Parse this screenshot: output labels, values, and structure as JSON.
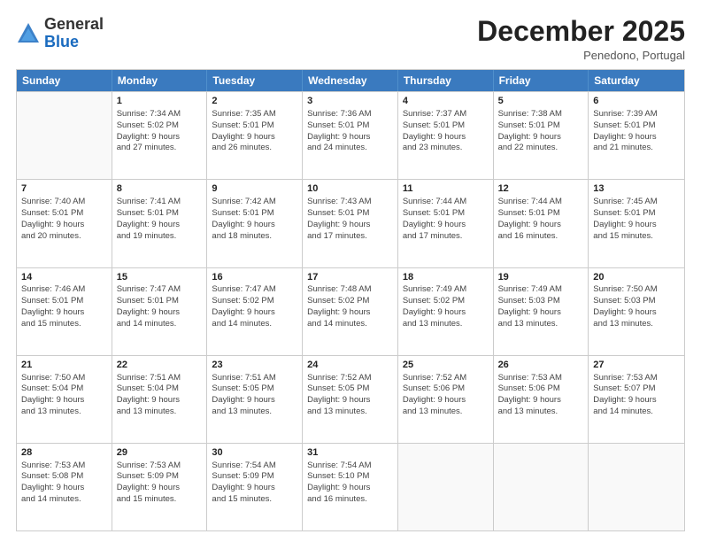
{
  "logo": {
    "general": "General",
    "blue": "Blue"
  },
  "header": {
    "month": "December 2025",
    "location": "Penedono, Portugal"
  },
  "days": [
    "Sunday",
    "Monday",
    "Tuesday",
    "Wednesday",
    "Thursday",
    "Friday",
    "Saturday"
  ],
  "weeks": [
    [
      {
        "day": "",
        "sunrise": "",
        "sunset": "",
        "daylight": "",
        "empty": true
      },
      {
        "day": "1",
        "sunrise": "Sunrise: 7:34 AM",
        "sunset": "Sunset: 5:02 PM",
        "daylight": "Daylight: 9 hours and 27 minutes.",
        "empty": false
      },
      {
        "day": "2",
        "sunrise": "Sunrise: 7:35 AM",
        "sunset": "Sunset: 5:01 PM",
        "daylight": "Daylight: 9 hours and 26 minutes.",
        "empty": false
      },
      {
        "day": "3",
        "sunrise": "Sunrise: 7:36 AM",
        "sunset": "Sunset: 5:01 PM",
        "daylight": "Daylight: 9 hours and 24 minutes.",
        "empty": false
      },
      {
        "day": "4",
        "sunrise": "Sunrise: 7:37 AM",
        "sunset": "Sunset: 5:01 PM",
        "daylight": "Daylight: 9 hours and 23 minutes.",
        "empty": false
      },
      {
        "day": "5",
        "sunrise": "Sunrise: 7:38 AM",
        "sunset": "Sunset: 5:01 PM",
        "daylight": "Daylight: 9 hours and 22 minutes.",
        "empty": false
      },
      {
        "day": "6",
        "sunrise": "Sunrise: 7:39 AM",
        "sunset": "Sunset: 5:01 PM",
        "daylight": "Daylight: 9 hours and 21 minutes.",
        "empty": false
      }
    ],
    [
      {
        "day": "7",
        "sunrise": "Sunrise: 7:40 AM",
        "sunset": "Sunset: 5:01 PM",
        "daylight": "Daylight: 9 hours and 20 minutes.",
        "empty": false
      },
      {
        "day": "8",
        "sunrise": "Sunrise: 7:41 AM",
        "sunset": "Sunset: 5:01 PM",
        "daylight": "Daylight: 9 hours and 19 minutes.",
        "empty": false
      },
      {
        "day": "9",
        "sunrise": "Sunrise: 7:42 AM",
        "sunset": "Sunset: 5:01 PM",
        "daylight": "Daylight: 9 hours and 18 minutes.",
        "empty": false
      },
      {
        "day": "10",
        "sunrise": "Sunrise: 7:43 AM",
        "sunset": "Sunset: 5:01 PM",
        "daylight": "Daylight: 9 hours and 17 minutes.",
        "empty": false
      },
      {
        "day": "11",
        "sunrise": "Sunrise: 7:44 AM",
        "sunset": "Sunset: 5:01 PM",
        "daylight": "Daylight: 9 hours and 17 minutes.",
        "empty": false
      },
      {
        "day": "12",
        "sunrise": "Sunrise: 7:44 AM",
        "sunset": "Sunset: 5:01 PM",
        "daylight": "Daylight: 9 hours and 16 minutes.",
        "empty": false
      },
      {
        "day": "13",
        "sunrise": "Sunrise: 7:45 AM",
        "sunset": "Sunset: 5:01 PM",
        "daylight": "Daylight: 9 hours and 15 minutes.",
        "empty": false
      }
    ],
    [
      {
        "day": "14",
        "sunrise": "Sunrise: 7:46 AM",
        "sunset": "Sunset: 5:01 PM",
        "daylight": "Daylight: 9 hours and 15 minutes.",
        "empty": false
      },
      {
        "day": "15",
        "sunrise": "Sunrise: 7:47 AM",
        "sunset": "Sunset: 5:01 PM",
        "daylight": "Daylight: 9 hours and 14 minutes.",
        "empty": false
      },
      {
        "day": "16",
        "sunrise": "Sunrise: 7:47 AM",
        "sunset": "Sunset: 5:02 PM",
        "daylight": "Daylight: 9 hours and 14 minutes.",
        "empty": false
      },
      {
        "day": "17",
        "sunrise": "Sunrise: 7:48 AM",
        "sunset": "Sunset: 5:02 PM",
        "daylight": "Daylight: 9 hours and 14 minutes.",
        "empty": false
      },
      {
        "day": "18",
        "sunrise": "Sunrise: 7:49 AM",
        "sunset": "Sunset: 5:02 PM",
        "daylight": "Daylight: 9 hours and 13 minutes.",
        "empty": false
      },
      {
        "day": "19",
        "sunrise": "Sunrise: 7:49 AM",
        "sunset": "Sunset: 5:03 PM",
        "daylight": "Daylight: 9 hours and 13 minutes.",
        "empty": false
      },
      {
        "day": "20",
        "sunrise": "Sunrise: 7:50 AM",
        "sunset": "Sunset: 5:03 PM",
        "daylight": "Daylight: 9 hours and 13 minutes.",
        "empty": false
      }
    ],
    [
      {
        "day": "21",
        "sunrise": "Sunrise: 7:50 AM",
        "sunset": "Sunset: 5:04 PM",
        "daylight": "Daylight: 9 hours and 13 minutes.",
        "empty": false
      },
      {
        "day": "22",
        "sunrise": "Sunrise: 7:51 AM",
        "sunset": "Sunset: 5:04 PM",
        "daylight": "Daylight: 9 hours and 13 minutes.",
        "empty": false
      },
      {
        "day": "23",
        "sunrise": "Sunrise: 7:51 AM",
        "sunset": "Sunset: 5:05 PM",
        "daylight": "Daylight: 9 hours and 13 minutes.",
        "empty": false
      },
      {
        "day": "24",
        "sunrise": "Sunrise: 7:52 AM",
        "sunset": "Sunset: 5:05 PM",
        "daylight": "Daylight: 9 hours and 13 minutes.",
        "empty": false
      },
      {
        "day": "25",
        "sunrise": "Sunrise: 7:52 AM",
        "sunset": "Sunset: 5:06 PM",
        "daylight": "Daylight: 9 hours and 13 minutes.",
        "empty": false
      },
      {
        "day": "26",
        "sunrise": "Sunrise: 7:53 AM",
        "sunset": "Sunset: 5:06 PM",
        "daylight": "Daylight: 9 hours and 13 minutes.",
        "empty": false
      },
      {
        "day": "27",
        "sunrise": "Sunrise: 7:53 AM",
        "sunset": "Sunset: 5:07 PM",
        "daylight": "Daylight: 9 hours and 14 minutes.",
        "empty": false
      }
    ],
    [
      {
        "day": "28",
        "sunrise": "Sunrise: 7:53 AM",
        "sunset": "Sunset: 5:08 PM",
        "daylight": "Daylight: 9 hours and 14 minutes.",
        "empty": false
      },
      {
        "day": "29",
        "sunrise": "Sunrise: 7:53 AM",
        "sunset": "Sunset: 5:09 PM",
        "daylight": "Daylight: 9 hours and 15 minutes.",
        "empty": false
      },
      {
        "day": "30",
        "sunrise": "Sunrise: 7:54 AM",
        "sunset": "Sunset: 5:09 PM",
        "daylight": "Daylight: 9 hours and 15 minutes.",
        "empty": false
      },
      {
        "day": "31",
        "sunrise": "Sunrise: 7:54 AM",
        "sunset": "Sunset: 5:10 PM",
        "daylight": "Daylight: 9 hours and 16 minutes.",
        "empty": false
      },
      {
        "day": "",
        "sunrise": "",
        "sunset": "",
        "daylight": "",
        "empty": true
      },
      {
        "day": "",
        "sunrise": "",
        "sunset": "",
        "daylight": "",
        "empty": true
      },
      {
        "day": "",
        "sunrise": "",
        "sunset": "",
        "daylight": "",
        "empty": true
      }
    ]
  ]
}
